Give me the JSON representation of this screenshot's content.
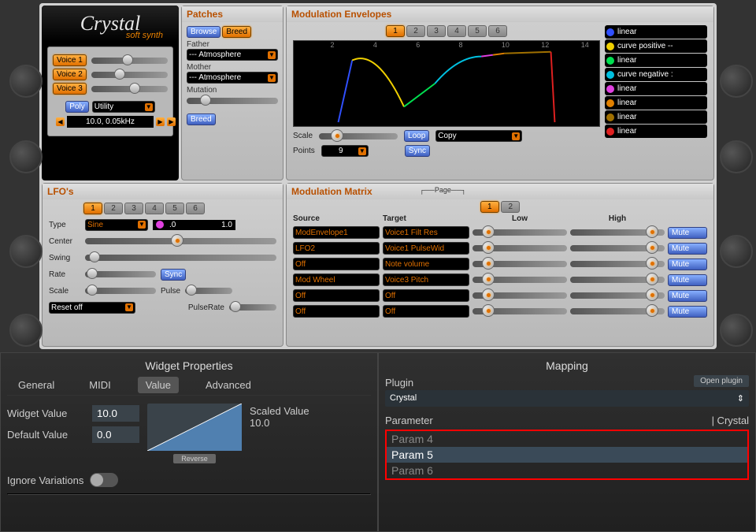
{
  "logo": {
    "title": "Crystal",
    "subtitle": "soft synth"
  },
  "voices": {
    "labels": [
      "Voice 1",
      "Voice 2",
      "Voice 3"
    ],
    "poly": "Poly",
    "utility": "Utility",
    "readout": "10.0, 0.05kHz"
  },
  "patches": {
    "header": "Patches",
    "browse": "Browse",
    "breed": "Breed",
    "father_label": "Father",
    "father_val": "--- Atmosphere",
    "mother_label": "Mother",
    "mother_val": "--- Atmosphere",
    "mutation_label": "Mutation",
    "breed_btn": "Breed"
  },
  "modenv": {
    "header": "Modulation Envelopes",
    "tabs": [
      "1",
      "2",
      "3",
      "4",
      "5",
      "6"
    ],
    "ticks": [
      "2",
      "4",
      "6",
      "8",
      "10",
      "12",
      "14"
    ],
    "scale_label": "Scale",
    "points_label": "Points",
    "points_val": "9",
    "loop": "Loop",
    "sync": "Sync",
    "copy": "Copy",
    "curves": [
      {
        "color": "#3050ff",
        "label": "linear"
      },
      {
        "color": "#f0d000",
        "label": "curve positive --"
      },
      {
        "color": "#00e050",
        "label": "linear"
      },
      {
        "color": "#00c0e0",
        "label": "curve negative :"
      },
      {
        "color": "#e040e0",
        "label": "linear"
      },
      {
        "color": "#e08000",
        "label": "linear"
      },
      {
        "color": "#a07000",
        "label": "linear"
      },
      {
        "color": "#e02020",
        "label": "linear"
      }
    ]
  },
  "lfo": {
    "header": "LFO's",
    "tabs": [
      "1",
      "2",
      "3",
      "4",
      "5",
      "6"
    ],
    "type_label": "Type",
    "type_val": "Sine",
    "type_readout_dot": "#e040e0",
    "type_readout_l": ".0",
    "type_readout_r": "1.0",
    "center_label": "Center",
    "swing_label": "Swing",
    "rate_label": "Rate",
    "sync": "Sync",
    "scale_label": "Scale",
    "pulse_label": "Pulse",
    "pulserate_label": "PulseRate",
    "reset": "Reset off"
  },
  "matrix": {
    "header": "Modulation Matrix",
    "page_label": "Page",
    "tabs": [
      "1",
      "2"
    ],
    "cols": {
      "source": "Source",
      "target": "Target",
      "low": "Low",
      "high": "High"
    },
    "mute": "Mute",
    "rows": [
      {
        "source": "ModEnvelope1",
        "target": "Voice1 Filt Res"
      },
      {
        "source": "LFO2",
        "target": "Voice1 PulseWid"
      },
      {
        "source": "Off",
        "target": "Note volume"
      },
      {
        "source": "Mod Wheel",
        "target": "Voice3 Pitch"
      },
      {
        "source": "Off",
        "target": "Off"
      },
      {
        "source": "Off",
        "target": "Off"
      }
    ]
  },
  "widget_props": {
    "title": "Widget Properties",
    "tabs": [
      "General",
      "MIDI",
      "Value",
      "Advanced"
    ],
    "active_tab": "Value",
    "widget_value_label": "Widget Value",
    "widget_value": "10.0",
    "default_value_label": "Default Value",
    "default_value": "0.0",
    "scaled_label": "Scaled Value",
    "scaled_value": "10.0",
    "reverse": "Reverse",
    "ignore_var": "Ignore Variations"
  },
  "mapping": {
    "title": "Mapping",
    "plugin_label": "Plugin",
    "open_plugin": "Open plugin",
    "plugin_val": "Crystal",
    "param_label": "Parameter",
    "param_right": "| Crystal",
    "params": [
      "Param 4",
      "Param 5",
      "Param 6"
    ],
    "selected_param": "Param 5"
  }
}
